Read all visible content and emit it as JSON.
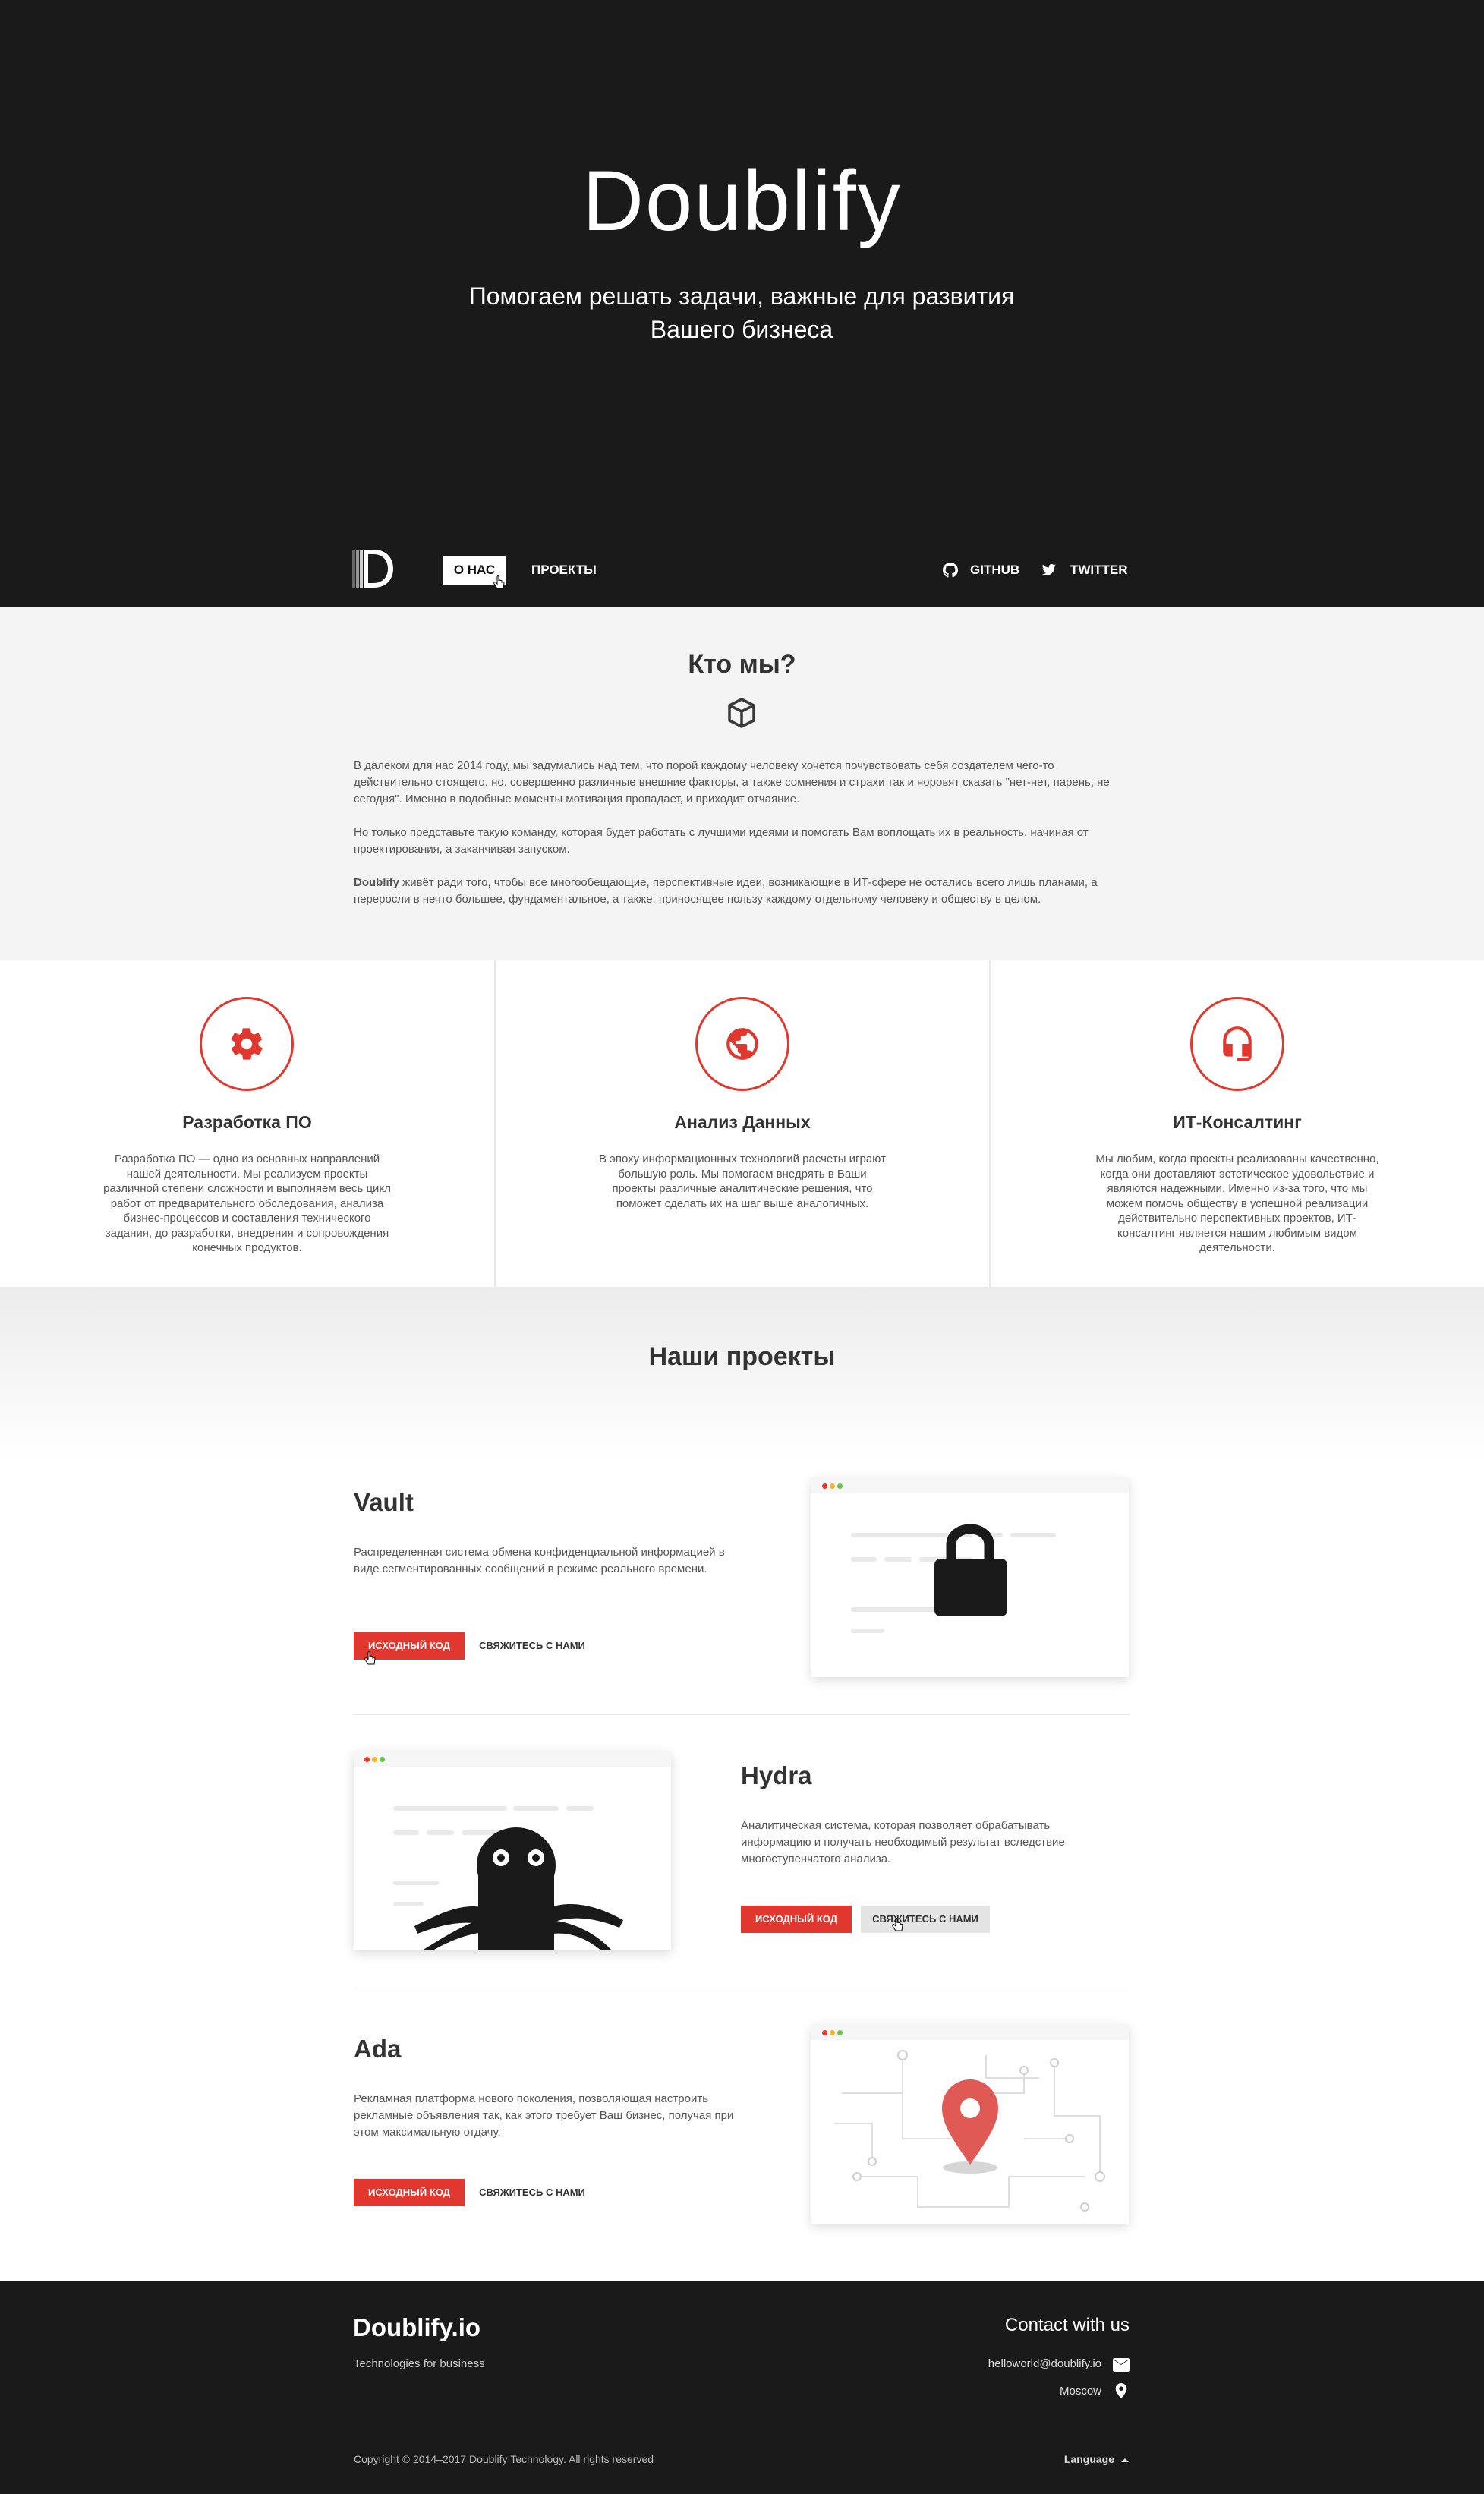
{
  "hero": {
    "title": "Doublify",
    "subtitle_line1": "Помогаем решать задачи, важные для развития",
    "subtitle_line2": "Вашего бизнеса"
  },
  "nav": {
    "logo_icon": "doublify-d-logo",
    "about": "О НАС",
    "projects": "ПРОЕКТЫ",
    "github": "GITHUB",
    "twitter": "TWITTER"
  },
  "about": {
    "title": "Кто мы?",
    "icon": "cube-icon",
    "p1": "В далеком для нас 2014 году, мы задумались над тем, что порой каждому человеку хочется почувствовать себя создателем чего-то действительно стоящего, но, совершенно различные внешние факторы, а также сомнения и страхи так и норовят сказать \"нет-нет, парень, не сегодня\". Именно в подобные моменты мотивация пропадает, и приходит отчаяние.",
    "p2": "Но только представьте такую команду, которая будет работать с лучшими идеями и помогать Вам воплощать их в реальность, начиная от проектирования, а заканчивая запуском.",
    "p3_brand": "Doublify",
    "p3_rest": " живёт ради того, чтобы все многообещающие, перспективные идеи, возникающие в ИТ-сфере не остались всего лишь планами, а переросли в нечто большее, фундаментальное, а также, приносящее пользу каждому отдельному человеку и обществу в целом."
  },
  "services": [
    {
      "icon": "gear-icon",
      "title": "Разработка ПО",
      "text": "Разработка ПО — одно из основных направлений нашей деятельности. Мы реализуем проекты различной степени сложности и выполняем весь цикл работ от предварительного обследования, анализа бизнес-процессов и составления технического задания, до разработки, внедрения и сопровождения конечных продуктов."
    },
    {
      "icon": "globe-icon",
      "title": "Анализ Данных",
      "text": "В эпоху информационных технологий расчеты играют большую роль. Мы помогаем внедрять в Ваши проекты различные аналитические решения, что поможет сделать их на шаг выше аналогичных."
    },
    {
      "icon": "headset-icon",
      "title": "ИТ-Консалтинг",
      "text": "Мы любим, когда проекты реализованы качественно, когда они доставляют эстетическое удовольствие и являются надежными. Именно из-за того, что мы можем помочь обществу в успешной реализации действительно перспективных проектов, ИТ-консалтинг является нашим любимым видом деятельности."
    }
  ],
  "projects": {
    "title": "Наши проекты",
    "items": [
      {
        "name": "Vault",
        "desc": "Распределенная система обмена конфиденциальной информацией в виде сегментированных сообщений в режиме реального времени.",
        "source_label": "ИСХОДНЫЙ КОД",
        "contact_label": "СВЯЖИТЕСЬ С НАМИ",
        "illustration": "lock-icon"
      },
      {
        "name": "Hydra",
        "desc": "Аналитическая система, которая позволяет обрабатывать информацию и получать необходимый результат вследствие многоступенчатого анализа.",
        "source_label": "ИСХОДНЫЙ КОД",
        "contact_label": "СВЯЖИТЕСЬ С НАМИ",
        "illustration": "octopus-icon"
      },
      {
        "name": "Ada",
        "desc": "Рекламная платформа нового поколения, позволяющая настроить рекламные объявления так, как этого требует Ваш бизнес, получая при этом максимальную отдачу.",
        "source_label": "ИСХОДНЫЙ КОД",
        "contact_label": "СВЯЖИТЕСЬ С НАМИ",
        "illustration": "map-pin-icon"
      }
    ]
  },
  "footer": {
    "brand": "Doublify.io",
    "tagline": "Technologies for business",
    "contact_title": "Contact with us",
    "email": "helloworld@doublify.io",
    "city": "Moscow",
    "copyright": "Copyright © 2014–2017 Doublify Technology. All rights reserved",
    "language": "Language"
  },
  "colors": {
    "dark": "#1b1a1b",
    "accent": "#e0372e",
    "light_bg": "#f4f4f4"
  }
}
